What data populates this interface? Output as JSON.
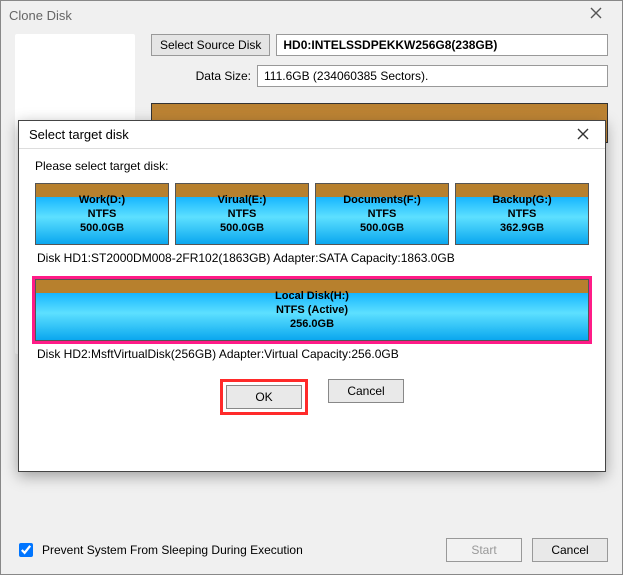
{
  "main": {
    "title": "Clone Disk",
    "select_source_label": "Select Source Disk",
    "source_disk": "HD0:INTELSSDPEKKW256G8(238GB)",
    "data_size_label": "Data Size:",
    "data_size_value": "111.6GB (234060385 Sectors).",
    "prevent_sleep_label": "Prevent System From Sleeping During Execution",
    "start_label": "Start",
    "cancel_label": "Cancel"
  },
  "modal": {
    "title": "Select target disk",
    "prompt": "Please select target disk:",
    "ok_label": "OK",
    "cancel_label": "Cancel",
    "disk1": {
      "desc": "Disk HD1:ST2000DM008-2FR102(1863GB)   Adapter:SATA   Capacity:1863.0GB",
      "partitions": [
        {
          "name": "Work(D:)",
          "fs": "NTFS",
          "size": "500.0GB"
        },
        {
          "name": "Virual(E:)",
          "fs": "NTFS",
          "size": "500.0GB"
        },
        {
          "name": "Documents(F:)",
          "fs": "NTFS",
          "size": "500.0GB"
        },
        {
          "name": "Backup(G:)",
          "fs": "NTFS",
          "size": "362.9GB"
        }
      ]
    },
    "disk2": {
      "desc": "Disk HD2:MsftVirtualDisk(256GB)   Adapter:Virtual   Capacity:256.0GB",
      "partition": {
        "name": "Local Disk(H:)",
        "fs": "NTFS (Active)",
        "size": "256.0GB"
      }
    }
  }
}
